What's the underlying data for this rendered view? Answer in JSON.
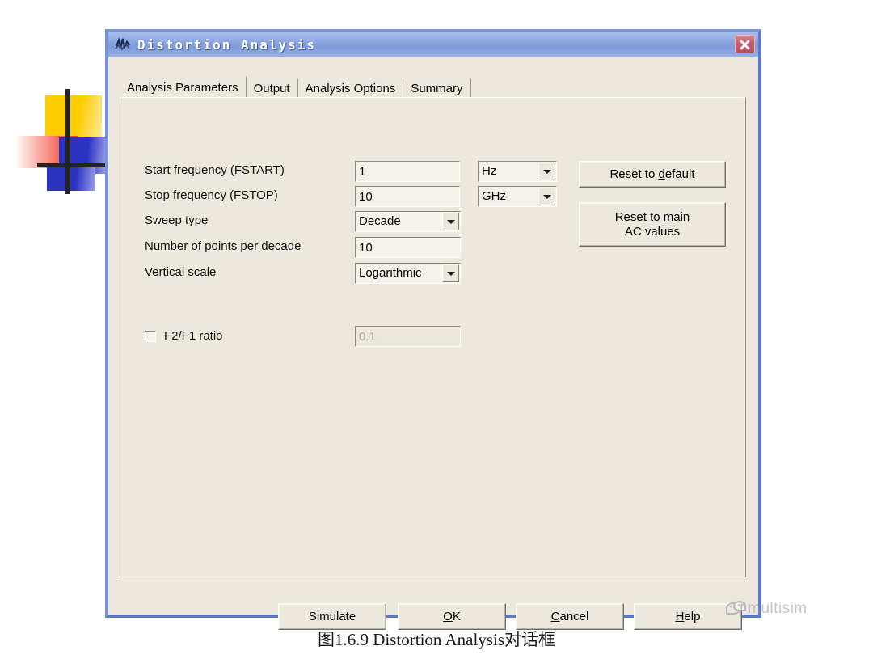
{
  "window": {
    "title": "Distortion Analysis",
    "icon": "distortion-waveform-icon",
    "close_label": "✕",
    "titlebar_color": "#8aa5e0",
    "border_color": "#5d79c4",
    "body_color": "#ece8de"
  },
  "tabs": [
    {
      "label": "Analysis Parameters",
      "active": true
    },
    {
      "label": "Output",
      "active": false
    },
    {
      "label": "Analysis Options",
      "active": false
    },
    {
      "label": "Summary",
      "active": false
    }
  ],
  "form": {
    "rows": [
      {
        "label": "Start frequency (FSTART)",
        "value": "1",
        "unit": "Hz"
      },
      {
        "label": "Stop frequency (FSTOP)",
        "value": "10",
        "unit": "GHz"
      }
    ],
    "sweep_type": {
      "label": "Sweep type",
      "value": "Decade"
    },
    "points_per_decade": {
      "label": "Number of points per decade",
      "value": "10"
    },
    "vertical_scale": {
      "label": "Vertical scale",
      "value": "Logarithmic"
    },
    "f2f1_ratio": {
      "label": "F2/F1 ratio",
      "checked": false,
      "value": "0.1",
      "enabled": false
    }
  },
  "side_buttons": {
    "reset_default": {
      "pre": "Reset to ",
      "mnemonic": "d",
      "post": "efault"
    },
    "reset_ac": {
      "line1_pre": "Reset to ",
      "line1_mnemonic": "m",
      "line1_post": "ain",
      "line2": "AC values"
    }
  },
  "footer_buttons": [
    {
      "pre": "Simulate",
      "mnemonic": "",
      "post": ""
    },
    {
      "pre": "",
      "mnemonic": "O",
      "post": "K"
    },
    {
      "pre": "",
      "mnemonic": "C",
      "post": "ancel"
    },
    {
      "pre": "",
      "mnemonic": "H",
      "post": "elp"
    }
  ],
  "caption": "图1.6.9 Distortion Analysis对话框",
  "watermark": {
    "text": "multisim",
    "icon": "wechat-icon"
  }
}
